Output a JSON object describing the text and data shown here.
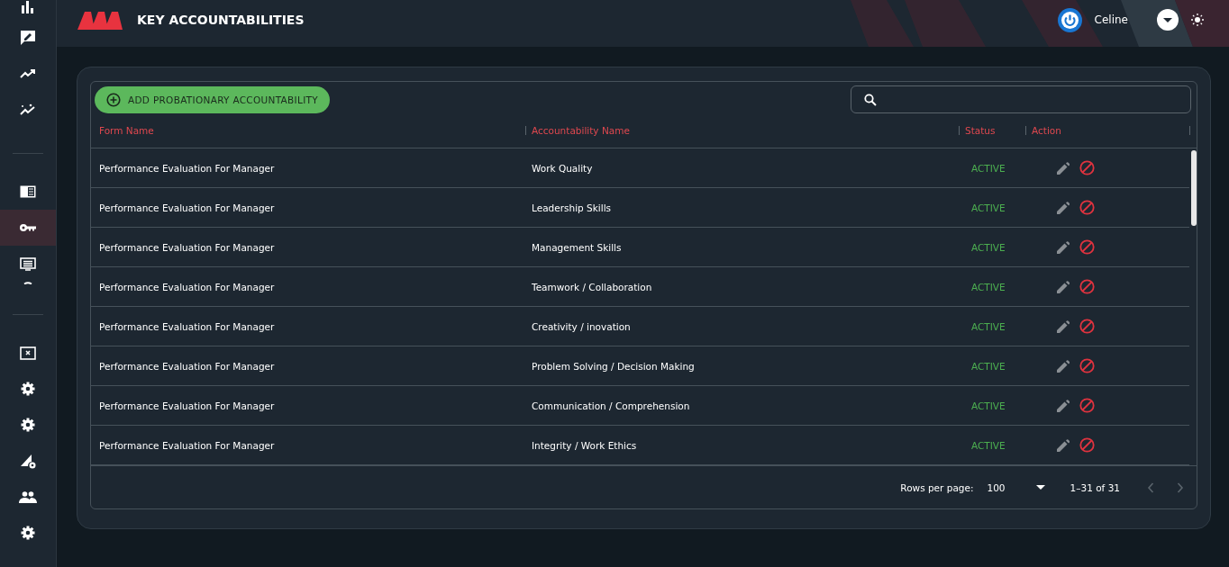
{
  "sidebar": {
    "groups": [
      [
        {
          "kind": "bar-chart",
          "selected": false
        },
        {
          "kind": "feedback",
          "selected": false
        },
        {
          "kind": "trend",
          "selected": false
        },
        {
          "kind": "sparkle-trend",
          "selected": false
        }
      ],
      [
        {
          "kind": "book",
          "selected": false
        },
        {
          "kind": "key",
          "selected": true
        },
        {
          "kind": "monitor",
          "selected": false
        },
        {
          "kind": "partial",
          "selected": false
        }
      ],
      [
        {
          "kind": "close-box",
          "selected": false
        },
        {
          "kind": "gear",
          "selected": false
        },
        {
          "kind": "gear",
          "selected": false
        },
        {
          "kind": "signal-gear",
          "selected": false
        },
        {
          "kind": "people",
          "selected": false
        },
        {
          "kind": "gear",
          "selected": false
        }
      ]
    ]
  },
  "header": {
    "title": "KEY ACCOUNTABILITIES",
    "user": "Celine"
  },
  "toolbar": {
    "add_button": "ADD PROBATIONARY ACCOUNTABILITY"
  },
  "table": {
    "columns": [
      "Form Name",
      "Accountability Name",
      "Status",
      "Action"
    ],
    "rows": [
      {
        "form_name": "Performance Evaluation For Manager",
        "accountability_name": "Work Quality",
        "status": "ACTIVE",
        "active": true
      },
      {
        "form_name": "Performance Evaluation For Manager",
        "accountability_name": "Leadership Skills",
        "status": "ACTIVE",
        "active": true
      },
      {
        "form_name": "Performance Evaluation For Manager",
        "accountability_name": "Management Skills",
        "status": "ACTIVE",
        "active": true
      },
      {
        "form_name": "Performance Evaluation For Manager",
        "accountability_name": "Teamwork / Collaboration",
        "status": "ACTIVE",
        "active": true
      },
      {
        "form_name": "Performance Evaluation For Manager",
        "accountability_name": "Creativity / inovation",
        "status": "ACTIVE",
        "active": true
      },
      {
        "form_name": "Performance Evaluation For Manager",
        "accountability_name": "Problem Solving / Decision Making",
        "status": "ACTIVE",
        "active": true
      },
      {
        "form_name": "Performance Evaluation For Manager",
        "accountability_name": "Communication / Comprehension",
        "status": "ACTIVE",
        "active": true
      },
      {
        "form_name": "Performance Evaluation For Manager",
        "accountability_name": "Integrity / Work Ethics",
        "status": "ACTIVE",
        "active": true
      }
    ]
  },
  "pagination": {
    "rows_per_page_label": "Rows per page:",
    "rows_per_page": "100",
    "range": "1–31 of 31"
  }
}
